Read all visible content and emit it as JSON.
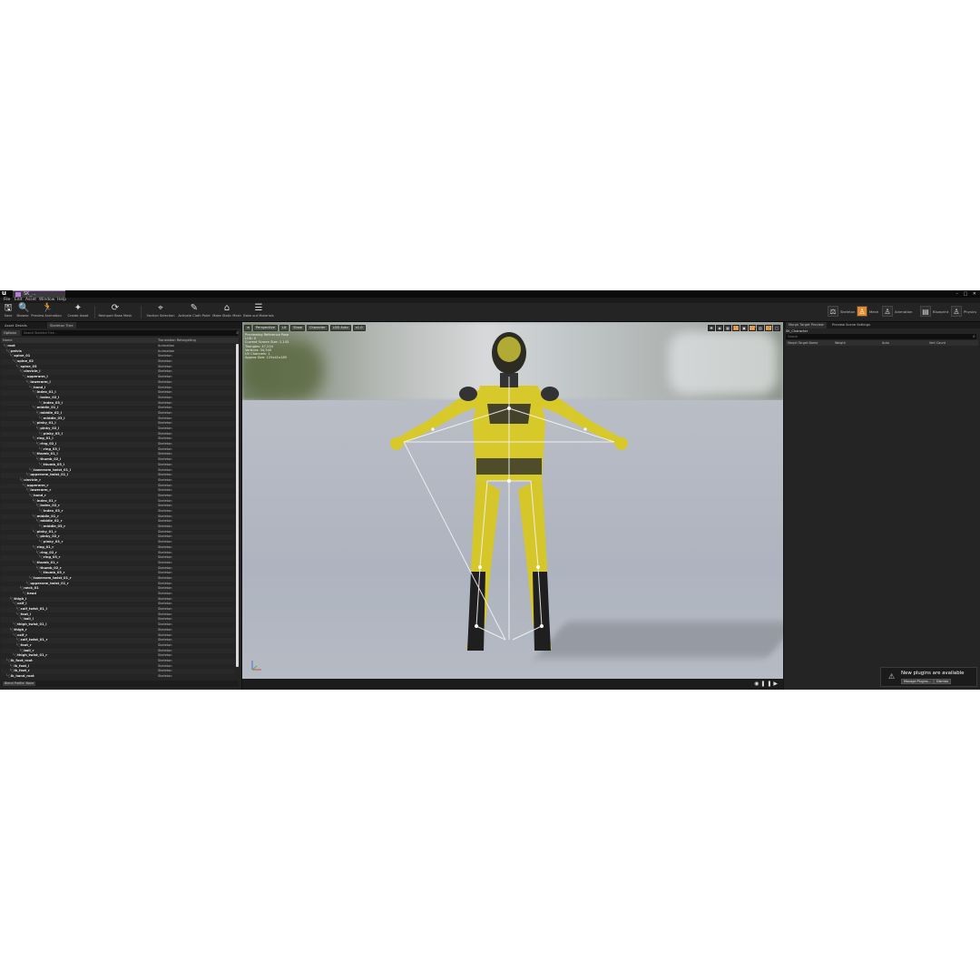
{
  "window": {
    "tab_title": "SK_...",
    "controls": "– □ ✕"
  },
  "menu": [
    "File",
    "Edit",
    "Asset",
    "Window",
    "Help"
  ],
  "toolbar": {
    "buttons": [
      {
        "label": "Save",
        "icon": "save-icon"
      },
      {
        "label": "Browse",
        "icon": "browse-icon"
      },
      {
        "label": "Preview Animation",
        "icon": "preview-animation-icon"
      },
      {
        "label": "Create Asset",
        "icon": "create-asset-icon"
      },
      {
        "label": "Reimport Base Mesh",
        "icon": "reimport-icon"
      },
      {
        "label": "Section Selection",
        "icon": "section-selection-icon"
      },
      {
        "label": "Activate Cloth Paint",
        "icon": "cloth-paint-icon"
      },
      {
        "label": "Make Static Mesh",
        "icon": "static-mesh-icon"
      },
      {
        "label": "Bake out Materials",
        "icon": "bake-materials-icon"
      }
    ],
    "modes": [
      {
        "label": "Skeleton",
        "active": false
      },
      {
        "label": "Mesh",
        "active": true
      },
      {
        "label": "Animation",
        "active": false
      },
      {
        "label": "Blueprint",
        "active": false
      },
      {
        "label": "Physics",
        "active": false
      }
    ]
  },
  "left_panel": {
    "tabs": [
      "Asset Details",
      "Skeleton Tree"
    ],
    "options_label": "Options",
    "search_placeholder": "Search Skeleton Tree...",
    "columns": {
      "name": "Name",
      "retarget": "Translation Retargeting"
    },
    "bones": [
      {
        "name": "root",
        "depth": 0,
        "mode": "Animation"
      },
      {
        "name": "pelvis",
        "depth": 1,
        "mode": "Animation"
      },
      {
        "name": "spine_01",
        "depth": 2,
        "mode": "Skeleton"
      },
      {
        "name": "spine_02",
        "depth": 3,
        "mode": "Skeleton"
      },
      {
        "name": "spine_03",
        "depth": 4,
        "mode": "Skeleton"
      },
      {
        "name": "clavicle_l",
        "depth": 5,
        "mode": "Skeleton"
      },
      {
        "name": "upperarm_l",
        "depth": 6,
        "mode": "Skeleton"
      },
      {
        "name": "lowerarm_l",
        "depth": 7,
        "mode": "Skeleton"
      },
      {
        "name": "hand_l",
        "depth": 8,
        "mode": "Skeleton"
      },
      {
        "name": "index_01_l",
        "depth": 9,
        "mode": "Skeleton"
      },
      {
        "name": "index_02_l",
        "depth": 10,
        "mode": "Skeleton"
      },
      {
        "name": "index_03_l",
        "depth": 11,
        "mode": "Skeleton"
      },
      {
        "name": "middle_01_l",
        "depth": 9,
        "mode": "Skeleton"
      },
      {
        "name": "middle_02_l",
        "depth": 10,
        "mode": "Skeleton"
      },
      {
        "name": "middle_03_l",
        "depth": 11,
        "mode": "Skeleton"
      },
      {
        "name": "pinky_01_l",
        "depth": 9,
        "mode": "Skeleton"
      },
      {
        "name": "pinky_02_l",
        "depth": 10,
        "mode": "Skeleton"
      },
      {
        "name": "pinky_03_l",
        "depth": 11,
        "mode": "Skeleton"
      },
      {
        "name": "ring_01_l",
        "depth": 9,
        "mode": "Skeleton"
      },
      {
        "name": "ring_02_l",
        "depth": 10,
        "mode": "Skeleton"
      },
      {
        "name": "ring_03_l",
        "depth": 11,
        "mode": "Skeleton"
      },
      {
        "name": "thumb_01_l",
        "depth": 9,
        "mode": "Skeleton"
      },
      {
        "name": "thumb_02_l",
        "depth": 10,
        "mode": "Skeleton"
      },
      {
        "name": "thumb_03_l",
        "depth": 11,
        "mode": "Skeleton"
      },
      {
        "name": "lowerarm_twist_01_l",
        "depth": 8,
        "mode": "Skeleton"
      },
      {
        "name": "upperarm_twist_01_l",
        "depth": 7,
        "mode": "Skeleton"
      },
      {
        "name": "clavicle_r",
        "depth": 5,
        "mode": "Skeleton"
      },
      {
        "name": "upperarm_r",
        "depth": 6,
        "mode": "Skeleton"
      },
      {
        "name": "lowerarm_r",
        "depth": 7,
        "mode": "Skeleton"
      },
      {
        "name": "hand_r",
        "depth": 8,
        "mode": "Skeleton"
      },
      {
        "name": "index_01_r",
        "depth": 9,
        "mode": "Skeleton"
      },
      {
        "name": "index_02_r",
        "depth": 10,
        "mode": "Skeleton"
      },
      {
        "name": "index_03_r",
        "depth": 11,
        "mode": "Skeleton"
      },
      {
        "name": "middle_01_r",
        "depth": 9,
        "mode": "Skeleton"
      },
      {
        "name": "middle_02_r",
        "depth": 10,
        "mode": "Skeleton"
      },
      {
        "name": "middle_03_r",
        "depth": 11,
        "mode": "Skeleton"
      },
      {
        "name": "pinky_01_r",
        "depth": 9,
        "mode": "Skeleton"
      },
      {
        "name": "pinky_02_r",
        "depth": 10,
        "mode": "Skeleton"
      },
      {
        "name": "pinky_03_r",
        "depth": 11,
        "mode": "Skeleton"
      },
      {
        "name": "ring_01_r",
        "depth": 9,
        "mode": "Skeleton"
      },
      {
        "name": "ring_02_r",
        "depth": 10,
        "mode": "Skeleton"
      },
      {
        "name": "ring_03_r",
        "depth": 11,
        "mode": "Skeleton"
      },
      {
        "name": "thumb_01_r",
        "depth": 9,
        "mode": "Skeleton"
      },
      {
        "name": "thumb_02_r",
        "depth": 10,
        "mode": "Skeleton"
      },
      {
        "name": "thumb_03_r",
        "depth": 11,
        "mode": "Skeleton"
      },
      {
        "name": "lowerarm_twist_01_r",
        "depth": 8,
        "mode": "Skeleton"
      },
      {
        "name": "upperarm_twist_01_r",
        "depth": 7,
        "mode": "Skeleton"
      },
      {
        "name": "neck_01",
        "depth": 5,
        "mode": "Skeleton"
      },
      {
        "name": "head",
        "depth": 6,
        "mode": "Skeleton"
      },
      {
        "name": "thigh_l",
        "depth": 2,
        "mode": "Skeleton"
      },
      {
        "name": "calf_l",
        "depth": 3,
        "mode": "Skeleton"
      },
      {
        "name": "calf_twist_01_l",
        "depth": 4,
        "mode": "Skeleton"
      },
      {
        "name": "foot_l",
        "depth": 4,
        "mode": "Skeleton"
      },
      {
        "name": "ball_l",
        "depth": 5,
        "mode": "Skeleton"
      },
      {
        "name": "thigh_twist_01_l",
        "depth": 3,
        "mode": "Skeleton"
      },
      {
        "name": "thigh_r",
        "depth": 2,
        "mode": "Skeleton"
      },
      {
        "name": "calf_r",
        "depth": 3,
        "mode": "Skeleton"
      },
      {
        "name": "calf_twist_01_r",
        "depth": 4,
        "mode": "Skeleton"
      },
      {
        "name": "foot_r",
        "depth": 4,
        "mode": "Skeleton"
      },
      {
        "name": "ball_r",
        "depth": 5,
        "mode": "Skeleton"
      },
      {
        "name": "thigh_twist_01_r",
        "depth": 3,
        "mode": "Skeleton"
      },
      {
        "name": "ik_foot_root",
        "depth": 1,
        "mode": "Skeleton"
      },
      {
        "name": "ik_foot_l",
        "depth": 2,
        "mode": "Skeleton"
      },
      {
        "name": "ik_foot_r",
        "depth": 2,
        "mode": "Skeleton"
      },
      {
        "name": "ik_hand_root",
        "depth": 1,
        "mode": "Skeleton"
      }
    ],
    "footer_button": "Blend Profile: None"
  },
  "viewport": {
    "toolbar": [
      "Perspective",
      "Lit",
      "Show",
      "Character",
      "LOD Auto",
      "x1.0"
    ],
    "info_lines": [
      "Previewing Reference Pose",
      "LOD: 0",
      "Current Screen Size: 1.143",
      "Triangles: 47,224",
      "Vertices: 34,545",
      "UV Channels: 1",
      "Approx Size: 125x41x185"
    ],
    "right_tools": [
      "✚",
      "◉",
      "▦",
      "10",
      "▣",
      "10°",
      "▧",
      "0.25",
      "▢"
    ]
  },
  "right_panel": {
    "tabs": [
      "Morph Target Preview",
      "Preview Scene Settings"
    ],
    "mesh_name": "SK_Character",
    "search_placeholder": "Search",
    "columns": [
      "Morph Target Name",
      "Weight",
      "Auto",
      "Vert Count"
    ]
  },
  "notification": {
    "text": "New plugins are available",
    "buttons": [
      "Manage Plugins...",
      "Dismiss"
    ]
  },
  "colors": {
    "suit_yellow": "#d8c92a",
    "suit_dark": "#2b2b2b",
    "mode_active": "#e58a2a"
  }
}
